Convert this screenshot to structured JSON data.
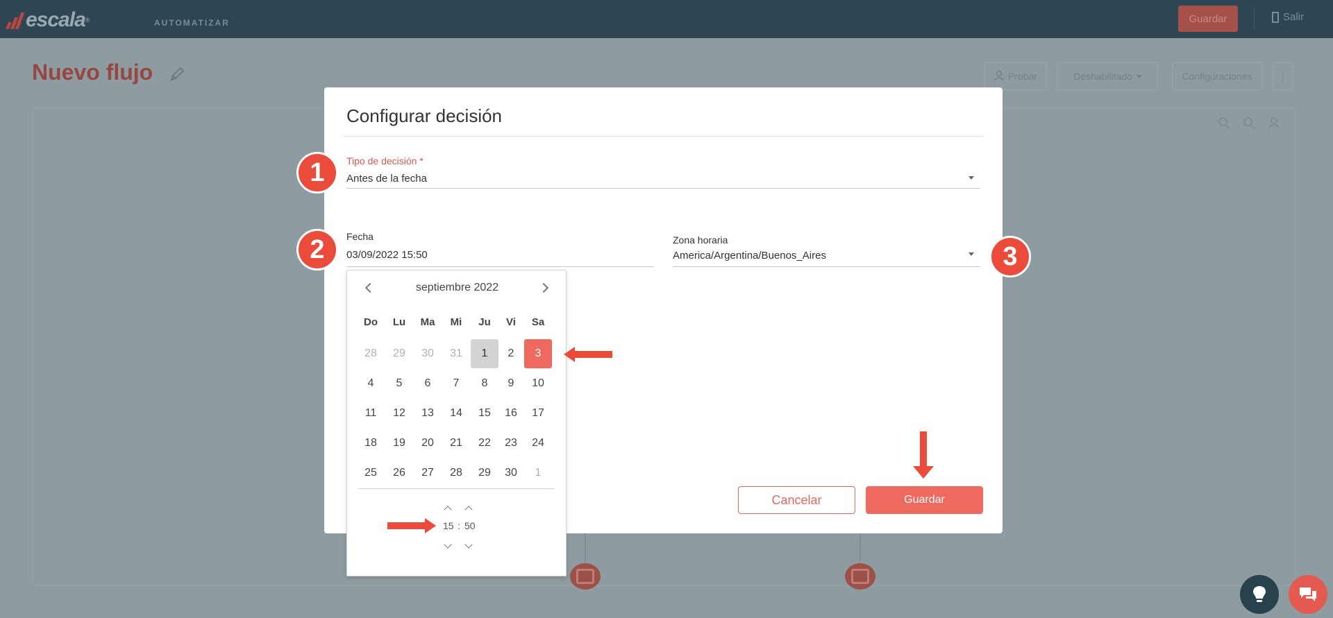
{
  "app": {
    "logo_text": "escala",
    "logo_mark": "®",
    "nav_item": "AUTOMATIZAR",
    "top_save_label": "Guardar",
    "logout_label": "Salir",
    "page_title": "Nuevo flujo",
    "toolbar": {
      "probar": "Probar",
      "status": "Deshabilitado",
      "configuraciones": "Configuraciones",
      "more": "⋮"
    }
  },
  "modal": {
    "title": "Configurar decisión",
    "decision_type": {
      "label": "Tipo de decisión *",
      "value": "Antes de la fecha"
    },
    "date": {
      "label": "Fecha",
      "value": "03/09/2022 15:50"
    },
    "timezone": {
      "label": "Zona horaria",
      "value": "America/Argentina/Buenos_Aires"
    },
    "cancel_label": "Cancelar",
    "save_label": "Guardar"
  },
  "datepicker": {
    "month_label": "septiembre 2022",
    "weekdays": [
      "Do",
      "Lu",
      "Ma",
      "Mi",
      "Ju",
      "Vi",
      "Sa"
    ],
    "weeks": [
      [
        "28",
        "29",
        "30",
        "31",
        "1",
        "2",
        "3"
      ],
      [
        "4",
        "5",
        "6",
        "7",
        "8",
        "9",
        "10"
      ],
      [
        "11",
        "12",
        "13",
        "14",
        "15",
        "16",
        "17"
      ],
      [
        "18",
        "19",
        "20",
        "21",
        "22",
        "23",
        "24"
      ],
      [
        "25",
        "26",
        "27",
        "28",
        "29",
        "30",
        "1"
      ]
    ],
    "hours": "15",
    "separator": ":",
    "minutes": "50"
  },
  "annotations": {
    "badge_1": "1",
    "badge_2": "2",
    "badge_3": "3"
  },
  "colors": {
    "accent": "#ef6a5e",
    "annotation": "#ea4b3a",
    "header_bg": "#2e4654"
  }
}
